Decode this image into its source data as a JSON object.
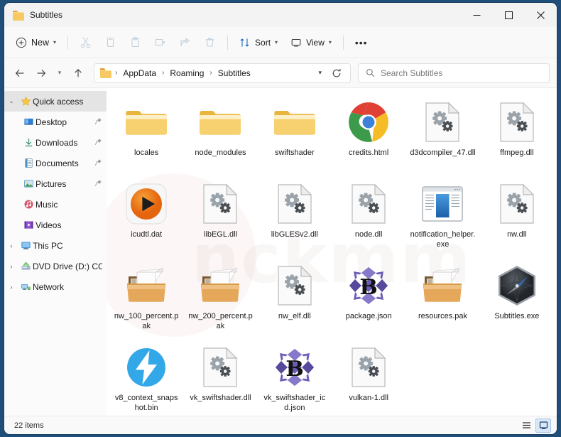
{
  "window": {
    "title": "Subtitles",
    "minimize_label": "–",
    "maximize_label": "□",
    "close_label": "✕"
  },
  "toolbar": {
    "new_label": "New",
    "cut_label": "Cut",
    "copy_label": "Copy",
    "paste_label": "Paste",
    "rename_label": "Rename",
    "share_label": "Share",
    "delete_label": "Delete",
    "sort_label": "Sort",
    "view_label": "View",
    "more_label": "•••"
  },
  "address": {
    "back_label": "Back",
    "forward_label": "Forward",
    "recent_label": "Recent locations",
    "up_label": "Up",
    "breadcrumbs": [
      "AppData",
      "Roaming",
      "Subtitles"
    ],
    "separator": "›",
    "refresh_label": "Refresh"
  },
  "search": {
    "placeholder": "Search Subtitles",
    "value": ""
  },
  "sidebar": {
    "items": [
      {
        "label": "Quick access",
        "icon": "star-icon",
        "expander": "⌄",
        "level": 0,
        "selected": true,
        "pinned": false
      },
      {
        "label": "Desktop",
        "icon": "desktop-icon",
        "expander": "",
        "level": 1,
        "selected": false,
        "pinned": true
      },
      {
        "label": "Downloads",
        "icon": "downloads-icon",
        "expander": "",
        "level": 1,
        "selected": false,
        "pinned": true
      },
      {
        "label": "Documents",
        "icon": "documents-icon",
        "expander": "",
        "level": 1,
        "selected": false,
        "pinned": true
      },
      {
        "label": "Pictures",
        "icon": "pictures-icon",
        "expander": "",
        "level": 1,
        "selected": false,
        "pinned": true
      },
      {
        "label": "Music",
        "icon": "music-icon",
        "expander": "",
        "level": 1,
        "selected": false,
        "pinned": false
      },
      {
        "label": "Videos",
        "icon": "videos-icon",
        "expander": "",
        "level": 1,
        "selected": false,
        "pinned": false
      },
      {
        "label": "This PC",
        "icon": "this-pc-icon",
        "expander": "›",
        "level": 0,
        "selected": false,
        "pinned": false
      },
      {
        "label": "DVD Drive (D:) CCCC",
        "icon": "dvd-drive-icon",
        "expander": "›",
        "level": 0,
        "selected": false,
        "pinned": false
      },
      {
        "label": "Network",
        "icon": "network-icon",
        "expander": "›",
        "level": 0,
        "selected": false,
        "pinned": false
      }
    ]
  },
  "files": [
    {
      "name": "locales",
      "icon": "folder-icon"
    },
    {
      "name": "node_modules",
      "icon": "folder-icon"
    },
    {
      "name": "swiftshader",
      "icon": "folder-icon"
    },
    {
      "name": "credits.html",
      "icon": "chrome-html-icon"
    },
    {
      "name": "d3dcompiler_47.dll",
      "icon": "dll-gears-icon"
    },
    {
      "name": "ffmpeg.dll",
      "icon": "dll-gears-icon"
    },
    {
      "name": "icudtl.dat",
      "icon": "media-player-icon"
    },
    {
      "name": "libEGL.dll",
      "icon": "dll-gears-icon"
    },
    {
      "name": "libGLESv2.dll",
      "icon": "dll-gears-icon"
    },
    {
      "name": "node.dll",
      "icon": "dll-gears-icon"
    },
    {
      "name": "notification_helper.exe",
      "icon": "app-window-icon"
    },
    {
      "name": "nw.dll",
      "icon": "dll-gears-icon"
    },
    {
      "name": "nw_100_percent.pak",
      "icon": "archive-box-icon"
    },
    {
      "name": "nw_200_percent.pak",
      "icon": "archive-box-icon"
    },
    {
      "name": "nw_elf.dll",
      "icon": "dll-gears-icon"
    },
    {
      "name": "package.json",
      "icon": "bridge-b-icon"
    },
    {
      "name": "resources.pak",
      "icon": "archive-box-icon"
    },
    {
      "name": "Subtitles.exe",
      "icon": "compass-hex-icon"
    },
    {
      "name": "v8_context_snapshot.bin",
      "icon": "blue-bolt-icon"
    },
    {
      "name": "vk_swiftshader.dll",
      "icon": "dll-gears-icon"
    },
    {
      "name": "vk_swiftshader_icd.json",
      "icon": "bridge-b-icon"
    },
    {
      "name": "vulkan-1.dll",
      "icon": "dll-gears-icon"
    }
  ],
  "status": {
    "item_count_label": "22 items",
    "details_view_label": "Details view",
    "large_icons_view_label": "Large icons view"
  },
  "watermark": {
    "text": "nckmm"
  },
  "colors": {
    "window_background": "#1f4e79",
    "chrome_background": "#f9f9f9",
    "folder_yellow": "#f6c963",
    "accent_blue": "#0078d4",
    "disabled_gray": "#c2cfdd"
  }
}
